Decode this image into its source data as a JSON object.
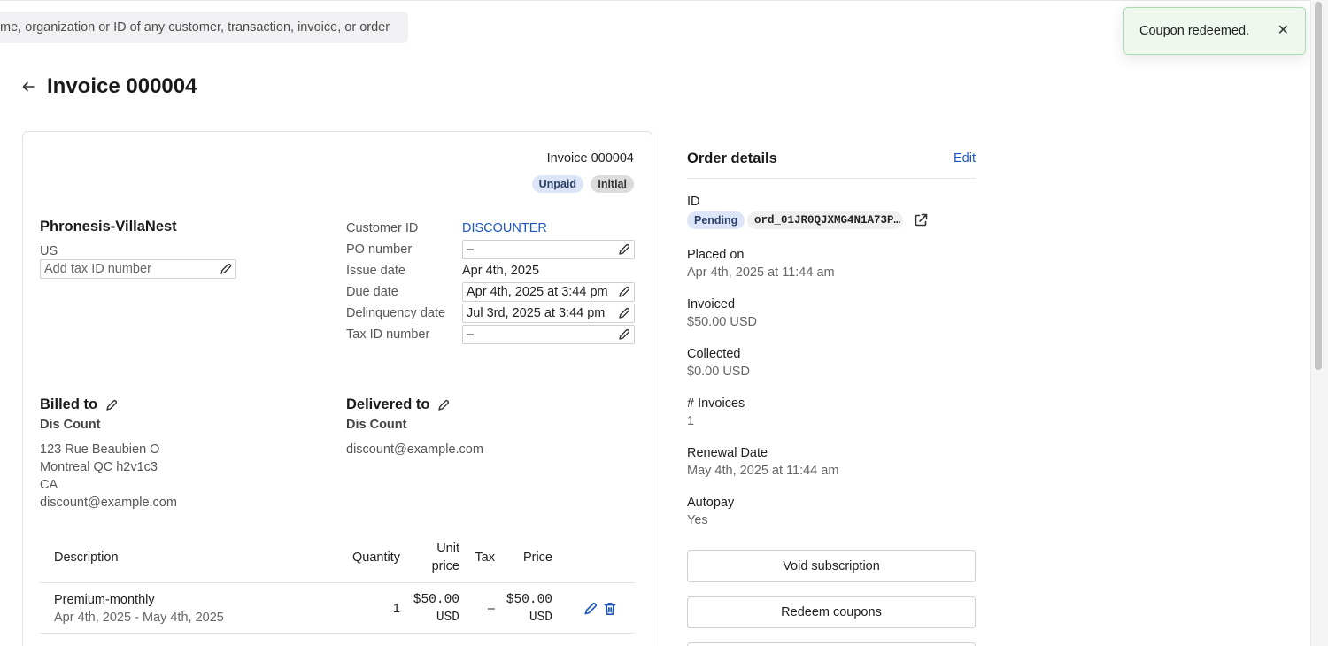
{
  "search": {
    "placeholder": "me, organization or ID of any customer, transaction, invoice, or order"
  },
  "page": {
    "back_icon": "arrow-left-icon",
    "title": "Invoice 000004"
  },
  "invoice": {
    "number": "Invoice 000004",
    "badges": {
      "unpaid": "Unpaid",
      "initial": "Initial"
    },
    "org": {
      "name": "Phronesis-VillaNest",
      "country": "US",
      "tax_placeholder": "Add tax ID number"
    },
    "fields": {
      "customer_id_label": "Customer ID",
      "customer_id_value": "DISCOUNTER",
      "po_label": "PO number",
      "po_value": "–",
      "issue_label": "Issue date",
      "issue_value": "Apr 4th, 2025",
      "due_label": "Due date",
      "due_value": "Apr 4th, 2025 at 3:44 pm",
      "delinq_label": "Delinquency date",
      "delinq_value": "Jul 3rd, 2025 at 3:44 pm",
      "taxid_label": "Tax ID number",
      "taxid_value": "–"
    },
    "billed_to": {
      "heading": "Billed to",
      "name": "Dis Count",
      "lines": [
        "123 Rue Beaubien O",
        "Montreal QC h2v1c3",
        "CA",
        "discount@example.com"
      ]
    },
    "delivered_to": {
      "heading": "Delivered to",
      "name": "Dis Count",
      "email": "discount@example.com"
    },
    "table": {
      "headers": {
        "description": "Description",
        "quantity": "Quantity",
        "unit_price_1": "Unit",
        "unit_price_2": "price",
        "tax": "Tax",
        "price": "Price"
      },
      "rows": [
        {
          "description": "Premium-monthly",
          "period": "Apr 4th, 2025 - May 4th, 2025",
          "quantity": "1",
          "unit_price_1": "$50.00",
          "unit_price_2": "USD",
          "tax": "–",
          "price_1": "$50.00",
          "price_2": "USD"
        }
      ]
    }
  },
  "order": {
    "heading": "Order details",
    "edit": "Edit",
    "id_label": "ID",
    "status": "Pending",
    "order_id": "ord_01JR0QJXMG4N1A73P…",
    "placed_label": "Placed on",
    "placed_value": "Apr 4th, 2025 at 11:44 am",
    "invoiced_label": "Invoiced",
    "invoiced_value": "$50.00 USD",
    "collected_label": "Collected",
    "collected_value": "$0.00 USD",
    "invoices_label": "# Invoices",
    "invoices_value": "1",
    "renewal_label": "Renewal Date",
    "renewal_value": "May 4th, 2025 at 11:44 am",
    "autopay_label": "Autopay",
    "autopay_value": "Yes",
    "buttons": {
      "void": "Void subscription",
      "redeem": "Redeem coupons"
    }
  },
  "toast": {
    "message": "Coupon redeemed.",
    "close": "✕"
  },
  "colors": {
    "link": "#1d55c4",
    "toast_bg": "#eef8ee",
    "toast_border": "#a9dbab",
    "badge_blue": "#dde6f8"
  }
}
